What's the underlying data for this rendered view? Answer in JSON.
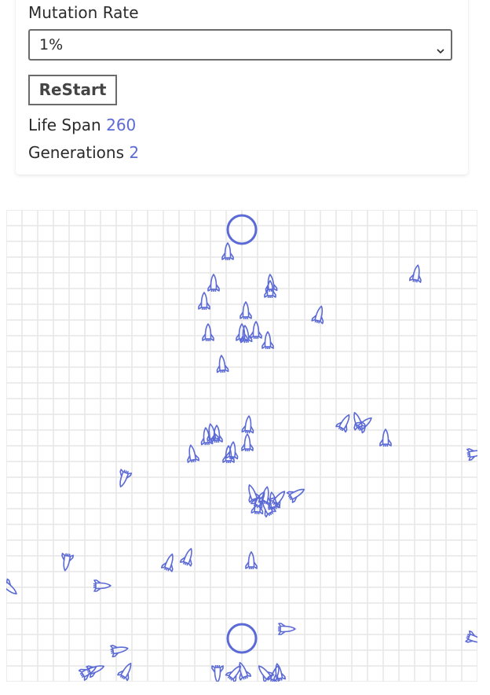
{
  "controls": {
    "mutation_label": "Mutation Rate",
    "mutation_value": "1%",
    "restart_label": "ReStart",
    "lifespan_label": "Life Span",
    "lifespan_value": "260",
    "generations_label": "Generations",
    "generations_value": "2"
  },
  "colors": {
    "accent": "#5b6ad6",
    "grid": "#e6e6e6",
    "border": "#6b6b6b",
    "text": "#2b2b2b"
  },
  "icons": {
    "rocket": "space-shuttle-icon",
    "target": "target-circle",
    "dropdown": "chevron-down-icon"
  }
}
